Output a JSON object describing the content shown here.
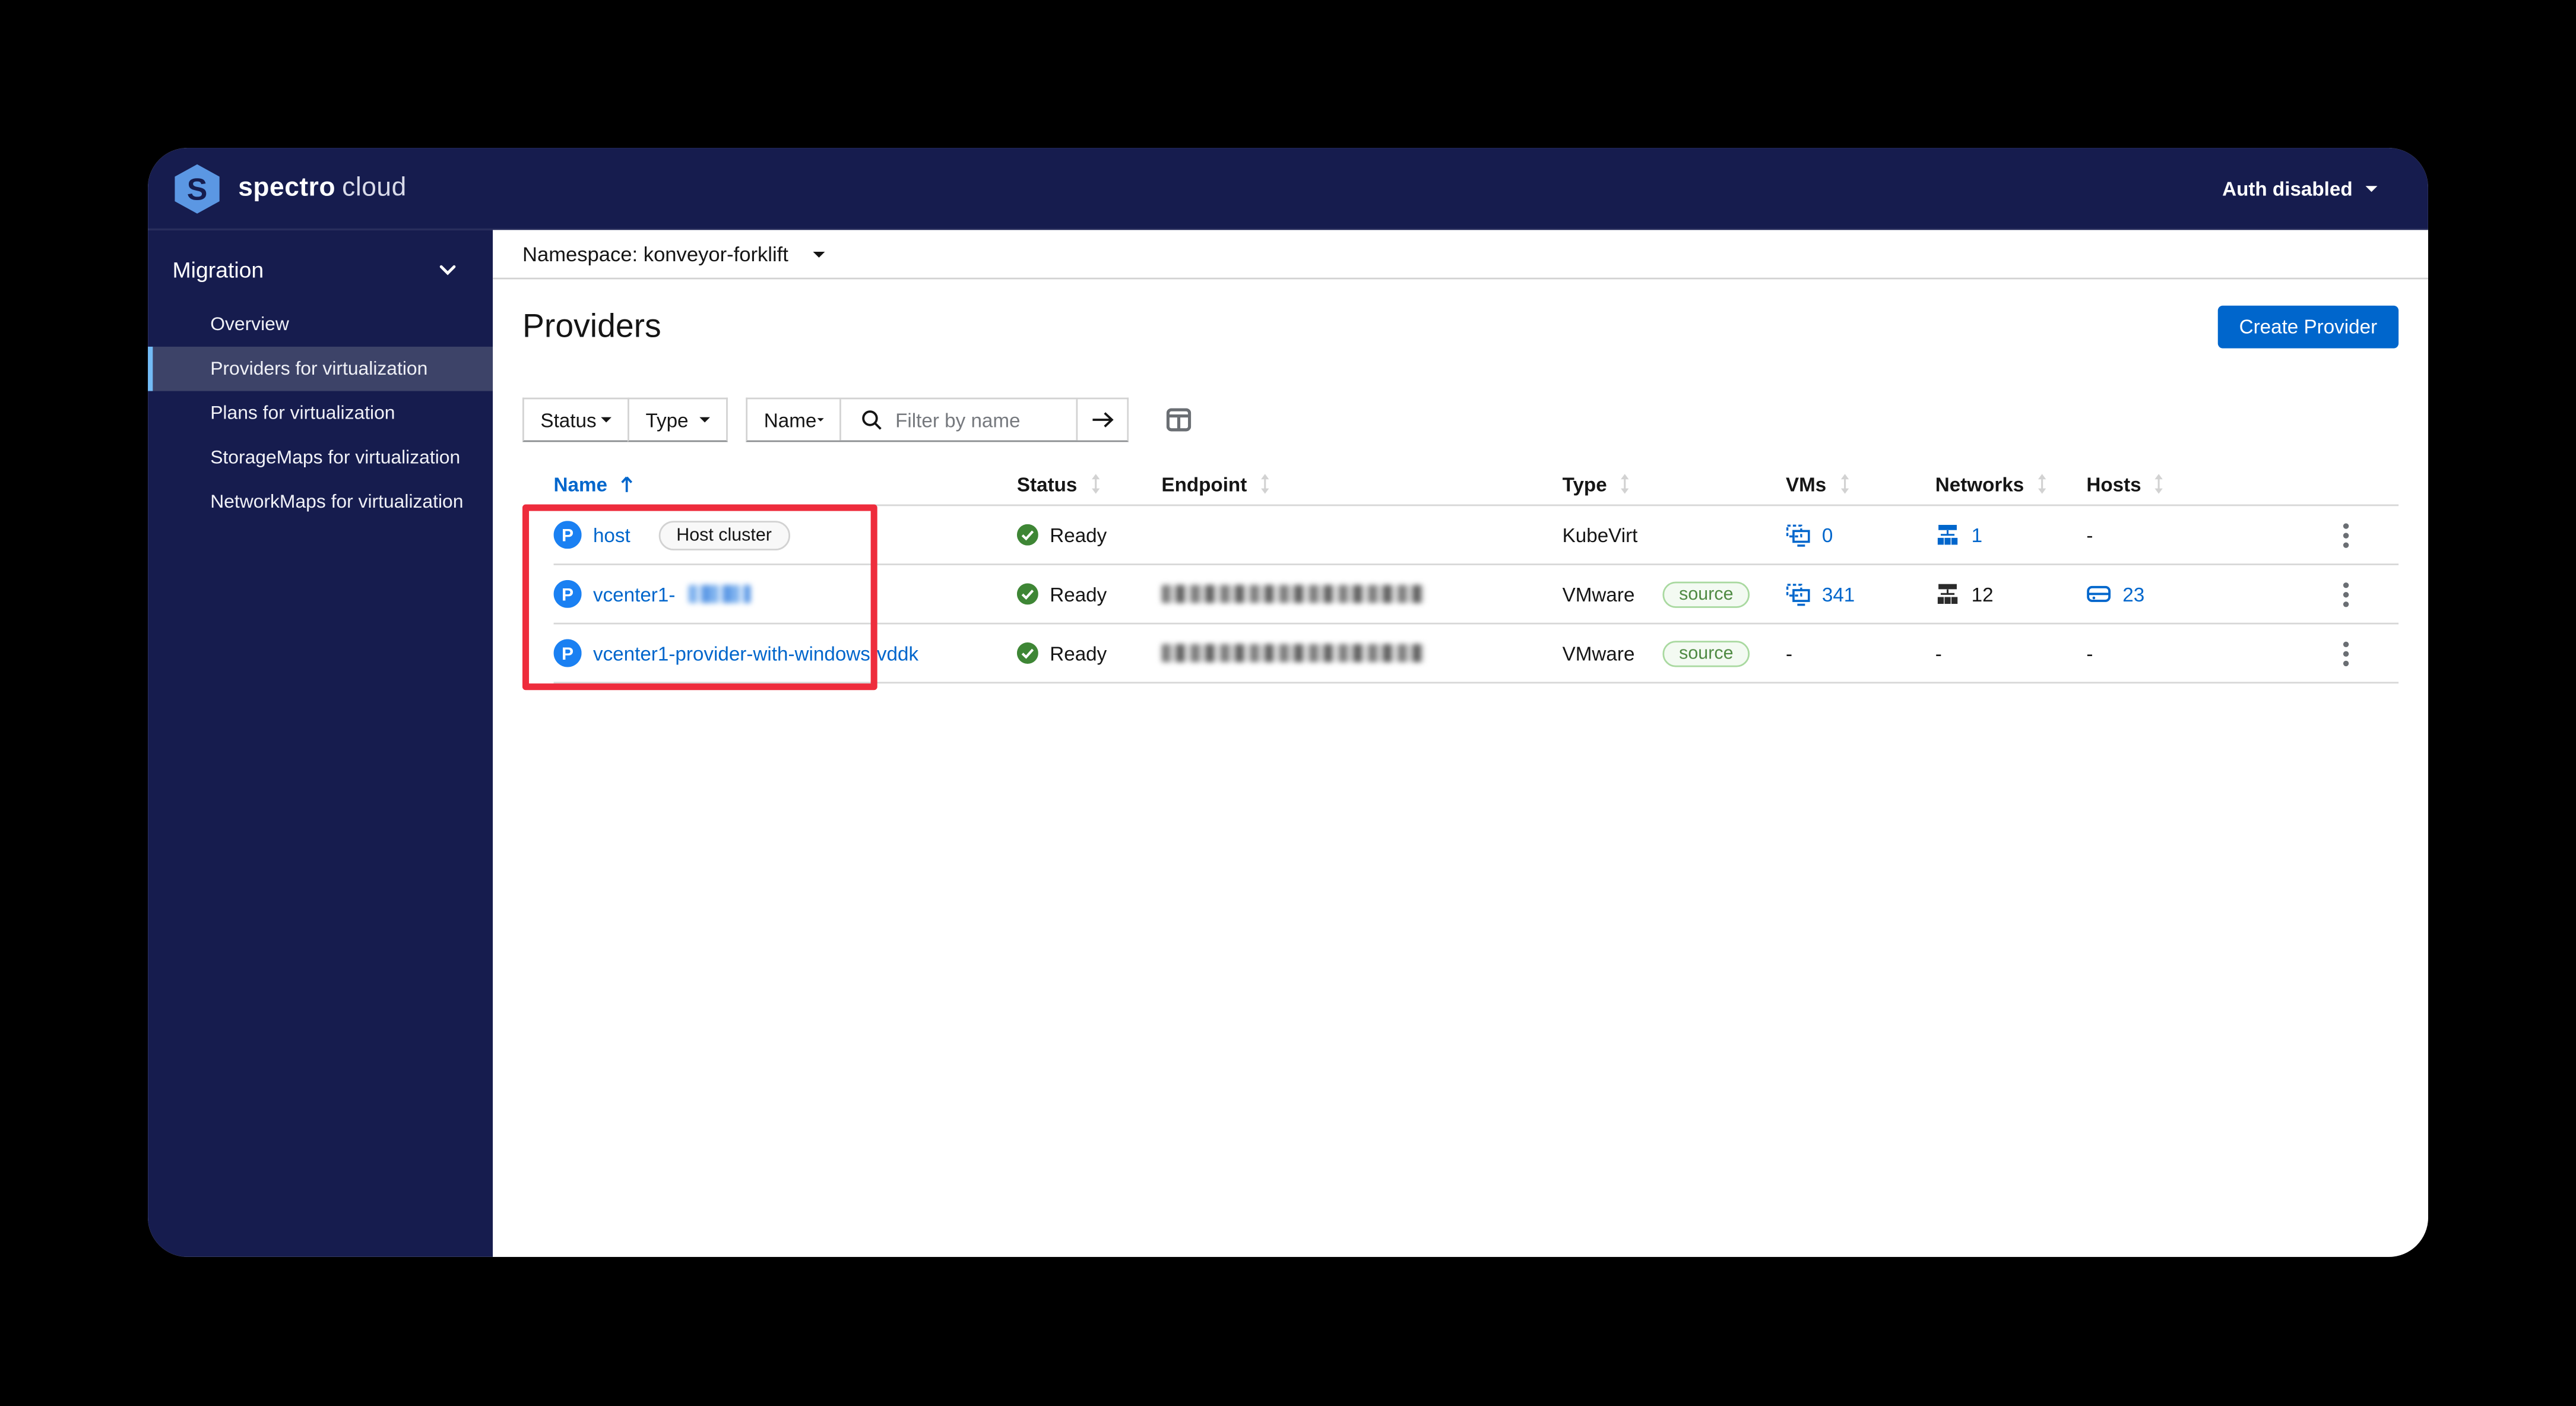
{
  "header": {
    "brand_primary": "spectro",
    "brand_secondary": "cloud",
    "auth_menu_label": "Auth disabled"
  },
  "sidebar": {
    "section_label": "Migration",
    "selected_index": 1,
    "items": [
      "Overview",
      "Providers for virtualization",
      "Plans for virtualization",
      "StorageMaps for virtualization",
      "NetworkMaps for virtualization"
    ]
  },
  "namespace_bar": {
    "label": "Namespace: konveyor-forklift"
  },
  "page": {
    "title": "Providers",
    "create_button_label": "Create Provider"
  },
  "toolbar": {
    "status_label": "Status",
    "type_label": "Type",
    "name_label": "Name",
    "search_placeholder": "Filter by name"
  },
  "table": {
    "columns": [
      "Name",
      "Status",
      "Endpoint",
      "Type",
      "VMs",
      "Networks",
      "Hosts"
    ],
    "sorted_column": "Name",
    "sort_direction": "asc",
    "rows": [
      {
        "name": "host",
        "name_badge": "Host cluster",
        "name_redacted_suffix": false,
        "status": "Ready",
        "endpoint": "",
        "endpoint_redacted": false,
        "type": "KubeVirt",
        "type_badge": "",
        "vms": {
          "value": "0",
          "link": true
        },
        "networks": {
          "value": "1",
          "link": true
        },
        "hosts": {
          "value": "-",
          "link": false
        }
      },
      {
        "name": "vcenter1-",
        "name_badge": "",
        "name_redacted_suffix": true,
        "status": "Ready",
        "endpoint": "",
        "endpoint_redacted": true,
        "type": "VMware",
        "type_badge": "source",
        "vms": {
          "value": "341",
          "link": true
        },
        "networks": {
          "value": "12",
          "link": false
        },
        "hosts": {
          "value": "23",
          "link": true
        }
      },
      {
        "name": "vcenter1-provider-with-windows-vddk",
        "name_badge": "",
        "name_redacted_suffix": false,
        "status": "Ready",
        "endpoint": "",
        "endpoint_redacted": true,
        "type": "VMware",
        "type_badge": "source",
        "vms": {
          "value": "-",
          "link": false
        },
        "networks": {
          "value": "-",
          "link": false
        },
        "hosts": {
          "value": "-",
          "link": false
        }
      }
    ]
  },
  "colors": {
    "navy": "#161c4e",
    "accent_blue": "#0066cc",
    "provider_icon_blue": "#1a80f2",
    "success_green": "#3e8635",
    "selected_nav_accent": "#73bcf7",
    "annotation_red": "#ee2c3c"
  }
}
